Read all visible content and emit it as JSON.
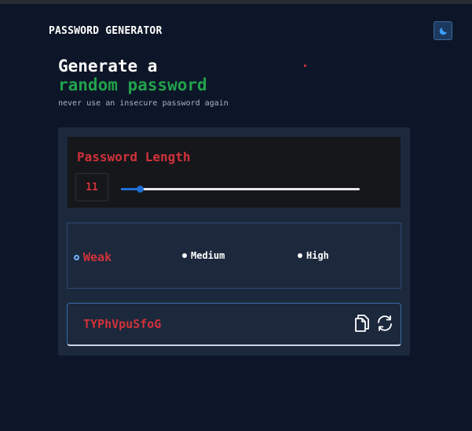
{
  "header": {
    "brand": "PASSWORD GENERATOR",
    "theme_icon": "moon-icon"
  },
  "hero": {
    "line1": "Generate a",
    "line2": "random password",
    "subtitle": "never use an insecure password again"
  },
  "length": {
    "title": "Password Length",
    "value": "11",
    "slider_fraction": 0.08
  },
  "strength": {
    "options": [
      {
        "label": "Weak",
        "selected": true
      },
      {
        "label": "Medium",
        "selected": false
      },
      {
        "label": "High",
        "selected": false
      }
    ]
  },
  "output": {
    "password": "TYPhVpuSfoG",
    "copy_icon": "copy-icon",
    "refresh_icon": "refresh-icon"
  },
  "colors": {
    "background": "#0d1628",
    "accent_green": "#22a24b",
    "accent_red": "#d0323a",
    "slider_blue": "#1f6fd6"
  }
}
